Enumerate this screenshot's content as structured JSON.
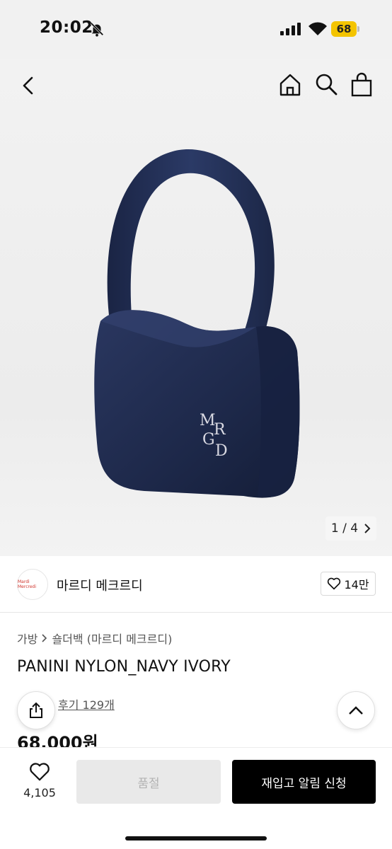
{
  "status_bar": {
    "time": "20:02",
    "battery": "68"
  },
  "icons": {
    "bell": "bell-off-icon",
    "signal": "signal-icon",
    "wifi": "wifi-icon",
    "back": "chevron-left-icon",
    "home": "home-icon",
    "search": "search-icon",
    "cart": "shopping-bag-icon",
    "like": "heart-icon",
    "share": "share-icon",
    "top": "chevron-up-icon"
  },
  "gallery": {
    "current": "1",
    "separator": "/",
    "total": "4"
  },
  "brand": {
    "name": "마르디 메크르디",
    "logo_text": "Mardi Mercredi",
    "likes": "14만"
  },
  "breadcrumb": {
    "category": "가방",
    "subcategory": "숄더백 (마르디 메크르디)"
  },
  "product": {
    "title": "PANINI NYLON_NAVY IVORY",
    "reviews": "후기 129개",
    "price": "68,000원",
    "bag_monogram": "MRGD"
  },
  "bottom_bar": {
    "wish_count": "4,105",
    "soldout_label": "품절",
    "restock_label": "재입고 알림 신청"
  },
  "colors": {
    "bag": "#1e2a4a",
    "accent": "#000000",
    "battery": "#f4c400"
  }
}
